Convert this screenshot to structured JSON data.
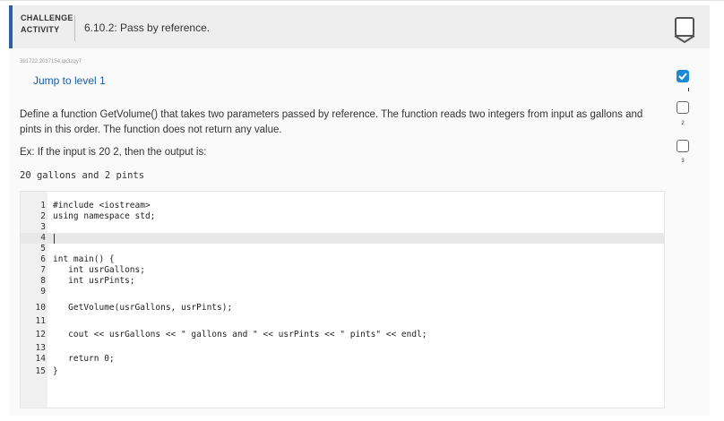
{
  "header": {
    "label_line1": "CHALLENGE",
    "label_line2": "ACTIVITY",
    "title": "6.10.2: Pass by reference."
  },
  "activity_id": "391722.2037154.qx3zqy7",
  "jump_link": "Jump to level 1",
  "description": "Define a function GetVolume() that takes two parameters passed by reference. The function reads two integers from input as gallons and pints in this order. The function does not return any value.",
  "example_text": "Ex: If the input is 20 2, then the output is:",
  "example_output": "20 gallons and 2 pints",
  "code": {
    "line_numbers": [
      "1",
      "2",
      "3",
      "4",
      "5",
      "6",
      "7",
      "8",
      "9",
      "10",
      "11",
      "12",
      "13",
      "14",
      "15"
    ],
    "lines": [
      "#include <iostream>",
      "using namespace std;",
      "",
      "",
      "",
      "int main() {",
      "   int usrGallons;",
      "   int usrPints;",
      "",
      "   GetVolume(usrGallons, usrPints);",
      "",
      "   cout << usrGallons << \" gallons and \" << usrPints << \" pints\" << endl;",
      "",
      "   return 0;",
      "}"
    ]
  },
  "levels": {
    "items": [
      {
        "number": "1",
        "state": "completed"
      },
      {
        "number": "2",
        "state": "open"
      },
      {
        "number": "3",
        "state": "open"
      }
    ]
  },
  "colors": {
    "accent": "#2c5fa3",
    "link": "#1a5ba5",
    "level_done": "#1c8ad1"
  }
}
